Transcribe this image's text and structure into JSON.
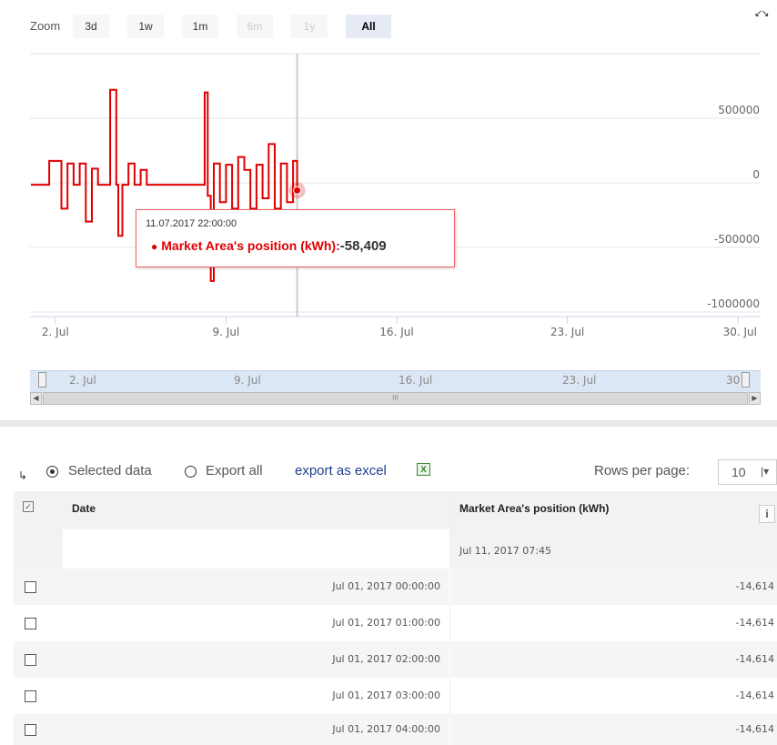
{
  "chart": {
    "zoom_label": "Zoom",
    "zoom_buttons": [
      {
        "label": "3d",
        "state": "enabled"
      },
      {
        "label": "1w",
        "state": "enabled"
      },
      {
        "label": "1m",
        "state": "enabled"
      },
      {
        "label": "6m",
        "state": "disabled"
      },
      {
        "label": "1y",
        "state": "disabled"
      },
      {
        "label": "All",
        "state": "active"
      }
    ],
    "fullscreen_icon": "expand-arrows-icon",
    "tooltip": {
      "time": "11.07.2017 22:00:00",
      "series": "Market Area's position (kWh):",
      "value": "-58,409"
    }
  },
  "chart_data": {
    "type": "line",
    "title": "",
    "xlabel": "",
    "ylabel": "",
    "x_tick_labels": [
      "2. Jul",
      "9. Jul",
      "16. Jul",
      "23. Jul",
      "30. Jul"
    ],
    "y_tick_labels": [
      "500000",
      "0",
      "-500000",
      "-1000000"
    ],
    "ylim": [
      -1000000,
      1000000
    ],
    "xlim": [
      "2017-07-01",
      "2017-07-31"
    ],
    "grid": true,
    "series": [
      {
        "name": "Market Area's position (kWh)",
        "color": "#e00000",
        "x": [
          "2017-07-01 00:00",
          "2017-07-01 12:00",
          "2017-07-01 18:00",
          "2017-07-02 00:00",
          "2017-07-02 06:00",
          "2017-07-02 12:00",
          "2017-07-02 18:00",
          "2017-07-03 00:00",
          "2017-07-03 06:00",
          "2017-07-03 12:00",
          "2017-07-03 18:00",
          "2017-07-04 00:00",
          "2017-07-04 06:00",
          "2017-07-04 12:00",
          "2017-07-04 14:00",
          "2017-07-04 18:00",
          "2017-07-05 00:00",
          "2017-07-05 06:00",
          "2017-07-05 12:00",
          "2017-07-05 18:00",
          "2017-07-06 00:00",
          "2017-07-06 12:00",
          "2017-07-07 00:00",
          "2017-07-07 12:00",
          "2017-07-08 00:00",
          "2017-07-08 03:00",
          "2017-07-08 06:00",
          "2017-07-08 09:00",
          "2017-07-08 12:00",
          "2017-07-08 18:00",
          "2017-07-09 00:00",
          "2017-07-09 06:00",
          "2017-07-09 12:00",
          "2017-07-09 18:00",
          "2017-07-10 00:00",
          "2017-07-10 06:00",
          "2017-07-10 12:00",
          "2017-07-10 18:00",
          "2017-07-11 00:00",
          "2017-07-11 06:00",
          "2017-07-11 12:00",
          "2017-07-11 18:00",
          "2017-07-11 22:00"
        ],
        "values": [
          -14614,
          -14614,
          170000,
          170000,
          -200000,
          150000,
          -14614,
          150000,
          -300000,
          110000,
          -14614,
          -14614,
          720000,
          -14614,
          -410000,
          -14614,
          150000,
          -14614,
          100000,
          -14614,
          -14614,
          -14614,
          -14614,
          -14614,
          -14614,
          700000,
          -100000,
          -760000,
          150000,
          -150000,
          140000,
          -200000,
          200000,
          100000,
          -200000,
          140000,
          -120000,
          300000,
          -200000,
          150000,
          -150000,
          170000,
          -58409
        ]
      }
    ]
  },
  "navigator": {
    "tick_labels": [
      "2. Jul",
      "9. Jul",
      "16. Jul",
      "23. Jul",
      "30"
    ],
    "scroll_grip": "III"
  },
  "export": {
    "option_selected": "Selected data",
    "option_all": "Export all",
    "excel_link": "export as excel",
    "rows_per_page_label": "Rows per page:",
    "rows_per_page_value": "10"
  },
  "table": {
    "columns": [
      "Date",
      "Market Area's position (kWh)"
    ],
    "filter_value": "Jul 11, 2017 07:45",
    "rows": [
      {
        "date": "Jul 01, 2017 00:00:00",
        "value": "-14,614"
      },
      {
        "date": "Jul 01, 2017 01:00:00",
        "value": "-14,614"
      },
      {
        "date": "Jul 01, 2017 02:00:00",
        "value": "-14,614"
      },
      {
        "date": "Jul 01, 2017 03:00:00",
        "value": "-14,614"
      },
      {
        "date": "Jul 01, 2017 04:00:00",
        "value": "-14,614"
      }
    ]
  }
}
